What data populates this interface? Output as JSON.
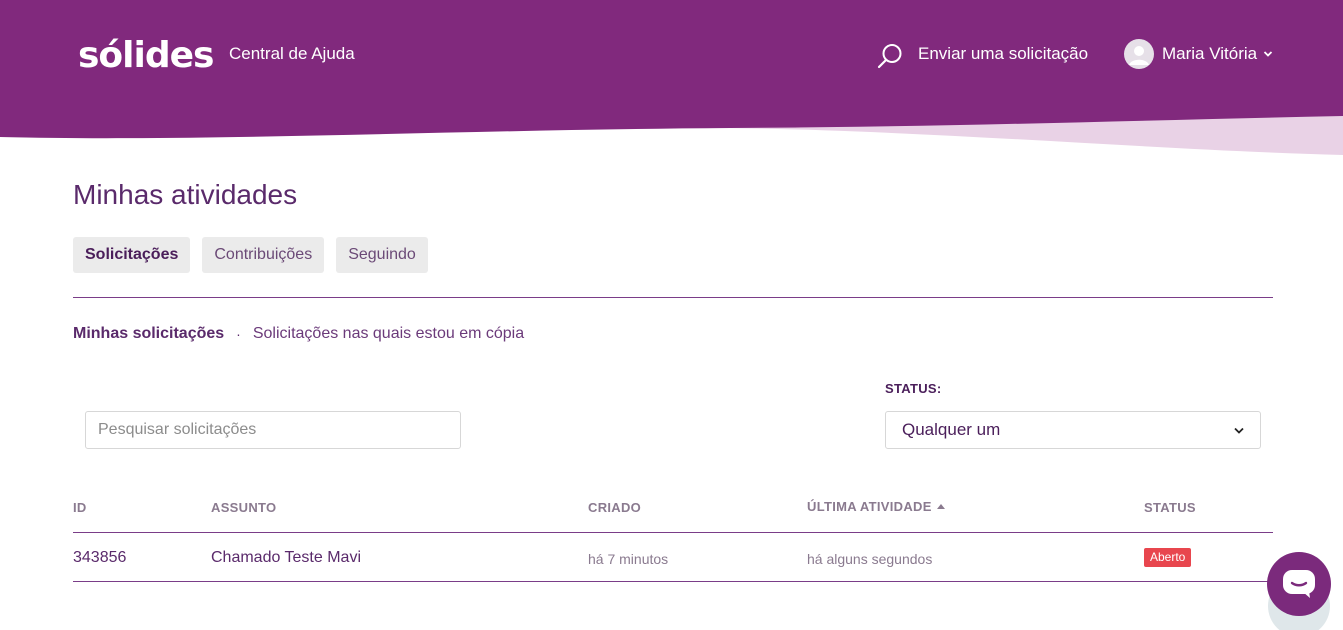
{
  "colors": {
    "header_purple": "#81297d",
    "header_wave_light": "#e9d2e6",
    "text_purple": "#5a2a6b",
    "divider": "#7a3d88",
    "badge_red": "#e8464e",
    "chat_purple": "#7b2a7c"
  },
  "header": {
    "logo_text": "sólides",
    "help_center": "Central de Ajuda",
    "search_icon": "search-icon",
    "send_request": "Enviar uma solicitação",
    "user": {
      "name": "Maria Vitória",
      "avatar_icon": "user-avatar-icon",
      "menu_icon": "chevron-down-icon"
    }
  },
  "page": {
    "title": "Minhas atividades",
    "tabs": [
      {
        "label": "Solicitações",
        "active": true
      },
      {
        "label": "Contribuições",
        "active": false
      },
      {
        "label": "Seguindo",
        "active": false
      }
    ],
    "sub_nav": {
      "current": "Minhas solicitações",
      "separator": "·",
      "link": "Solicitações nas quais estou em cópia"
    }
  },
  "filters": {
    "search_placeholder": "Pesquisar solicitações",
    "status_label": "STATUS:",
    "status_selected": "Qualquer um"
  },
  "table": {
    "headers": {
      "id": "ID",
      "subject": "ASSUNTO",
      "created": "CRIADO",
      "last_activity": "ÚLTIMA ATIVIDADE",
      "status": "STATUS"
    },
    "rows": [
      {
        "id": "343856",
        "subject": "Chamado Teste Mavi",
        "created": "há 7 minutos",
        "last_activity": "há alguns segundos",
        "status": "Aberto"
      }
    ]
  },
  "chat_widget": {
    "icon": "chat-bubble-icon"
  }
}
